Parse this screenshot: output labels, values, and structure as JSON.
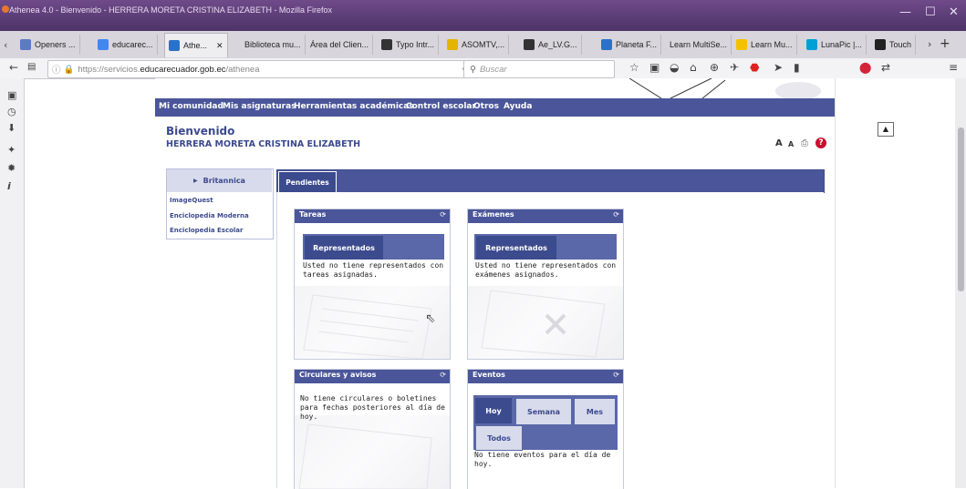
{
  "window": {
    "title": "Athenea 4.0 - Bienvenido - HERRERA MORETA CRISTINA ELIZABETH - Mozilla Firefox",
    "controls": [
      "—",
      "☐",
      "✕"
    ]
  },
  "tabs": [
    {
      "label": "Openers ...",
      "color": "#5b7bc4"
    },
    {
      "label": "educarec...",
      "color": "#4285f4"
    },
    {
      "label": "Athe...",
      "color": "#2a72c9",
      "active": true
    },
    {
      "label": "Biblioteca mu...",
      "color": "#cccccc"
    },
    {
      "label": "Área del Clien...",
      "color": "#cccccc"
    },
    {
      "label": "Typo Intr...",
      "color": "#333333"
    },
    {
      "label": "ASOMTV,...",
      "color": "#e3b400"
    },
    {
      "label": "Ae_LV.G...",
      "color": "#333333"
    },
    {
      "label": "Planeta F...",
      "color": "#2a72c9"
    },
    {
      "label": "Learn MultiSe...",
      "color": "#cccccc"
    },
    {
      "label": "Learn Mu...",
      "color": "#f2c100"
    },
    {
      "label": "LunaPic |...",
      "color": "#00a0d6"
    },
    {
      "label": "Touch",
      "color": "#222222"
    }
  ],
  "navbar": {
    "url_prefix": "https://servicios.",
    "url_domain": "educarecuador.gob.ec",
    "url_path": "/athenea",
    "search_placeholder": "Buscar"
  },
  "site": {
    "menu": [
      "Mi comunidad",
      "Mis asignaturas",
      "Herramientas académicas",
      "Control escolar",
      "Otros",
      "Ayuda"
    ],
    "welcome": "Bienvenido",
    "user": "HERRERA MORETA CRISTINA ELIZABETH",
    "sidebar_header": "Britannica",
    "sidebar_items": [
      "ImageQuest",
      "Enciclopedia Moderna",
      "Enciclopedia Escolar"
    ],
    "content_tab": "Pendientes",
    "widgets": {
      "tareas": {
        "title": "Tareas",
        "tab": "Representados",
        "text": "Usted no tiene representados con tareas asignadas."
      },
      "examenes": {
        "title": "Exámenes",
        "tab": "Representados",
        "text": "Usted no tiene representados con exámenes asignados."
      },
      "circulares": {
        "title": "Circulares y avisos",
        "text": "No tiene circulares o boletines para fechas posteriores al día de hoy."
      },
      "eventos": {
        "title": "Eventos",
        "tabs": [
          "Hoy",
          "Semana",
          "Mes",
          "Todos"
        ],
        "text": "No tiene eventos para el día de hoy."
      }
    }
  },
  "colors": {
    "brand": "#4a5699",
    "brand_dark": "#3c4a8e"
  }
}
